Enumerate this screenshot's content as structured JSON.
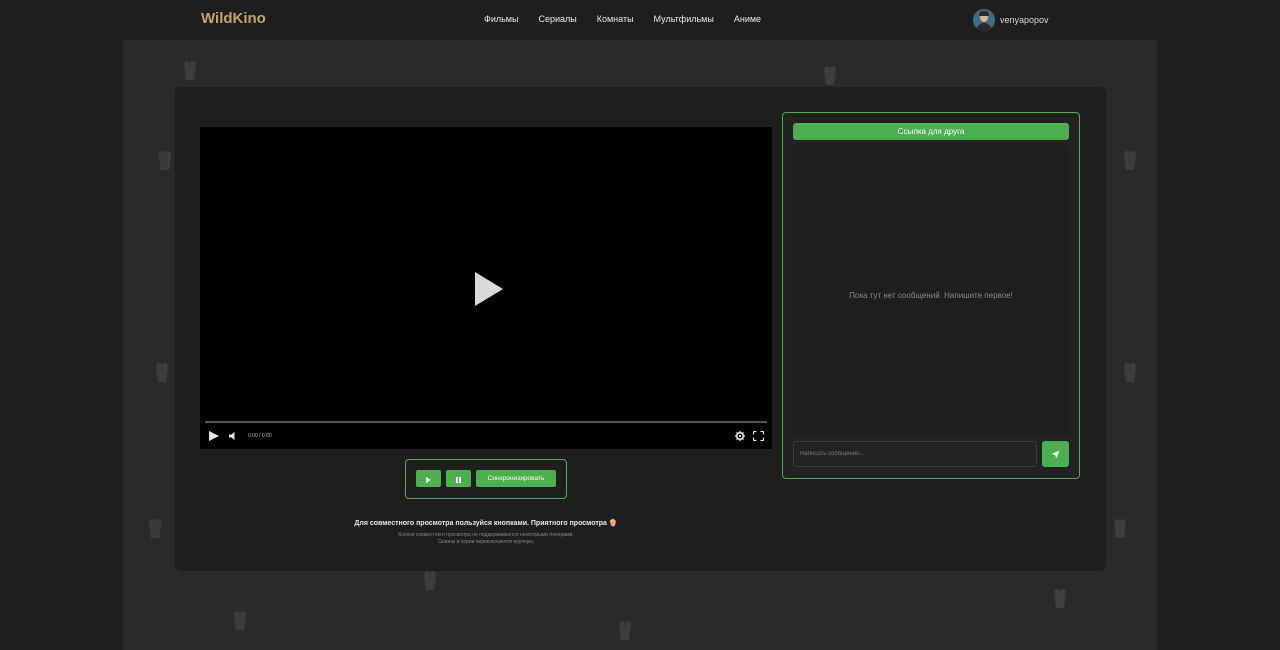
{
  "header": {
    "logo": "WildKino",
    "nav": [
      "Фильмы",
      "Сериалы",
      "Комнаты",
      "Мультфильмы",
      "Аниме"
    ],
    "username": "venyapopov"
  },
  "player": {
    "time": "0:00 / 0:00"
  },
  "sync": {
    "sync_label": "Синхронизировать"
  },
  "hints": {
    "main": "Для совместного просмотра пользуйся кнопками. Приятного просмотра 🍿",
    "sub1": "Кнопки совместного просмотра не поддерживаются некоторыми плеерами.",
    "sub2": "Сезоны и серии переключаются вручную."
  },
  "chat": {
    "friend_link": "Ссылка для друга",
    "empty": "Пока тут нет сообщений. Напишите первое!",
    "input_placeholder": "Написать сообщение..."
  },
  "colors": {
    "accent": "#4caf50",
    "logo": "#c9a56b"
  }
}
